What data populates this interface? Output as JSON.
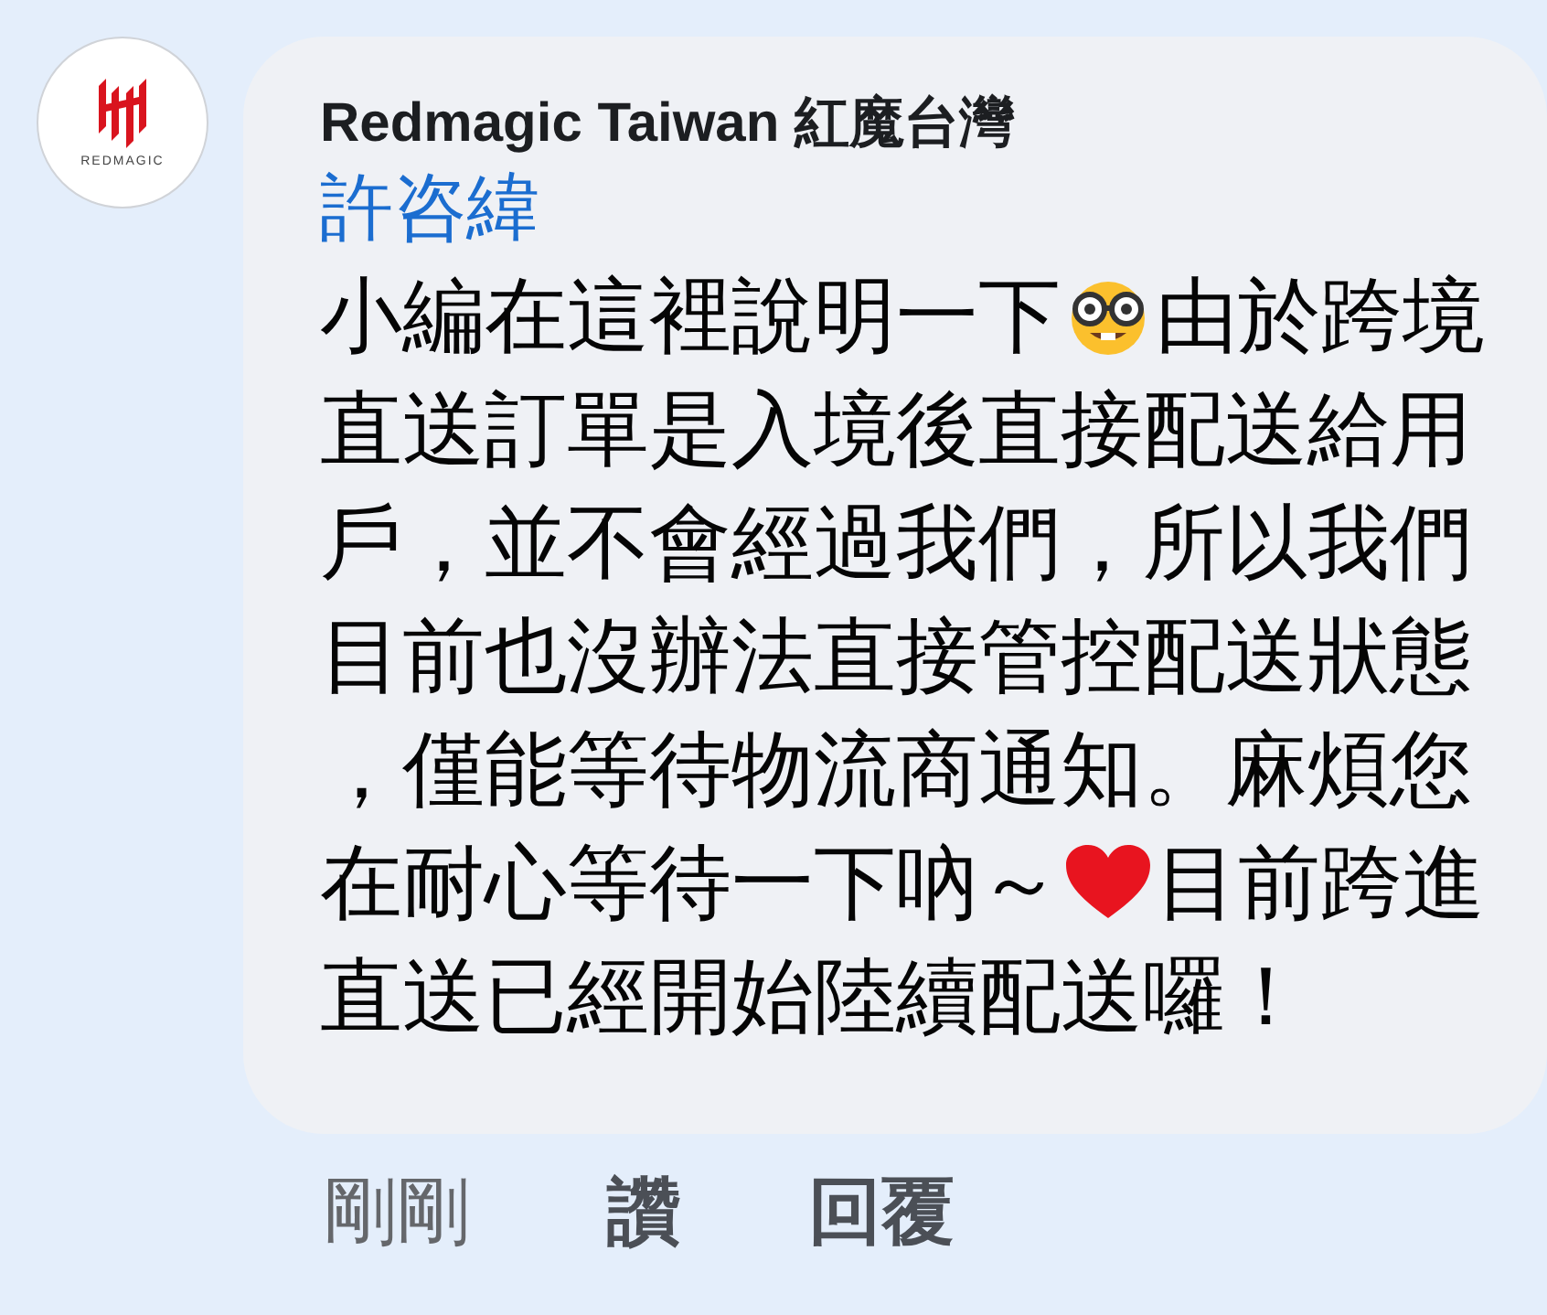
{
  "comment": {
    "avatar": {
      "logo_text": "REDMAGIC"
    },
    "author": "Redmagic Taiwan 紅魔台灣",
    "mention": "許咨緯",
    "body_lines": [
      [
        {
          "kind": "text",
          "text": "小編在這裡說明一下"
        },
        {
          "kind": "nerd_emoji"
        },
        {
          "kind": "text",
          "text": "由於跨境"
        }
      ],
      [
        {
          "kind": "text",
          "text": "直送訂單是入境後直接配送給用"
        }
      ],
      [
        {
          "kind": "text",
          "text": "戶，並不會經過我們，所以我們"
        }
      ],
      [
        {
          "kind": "text",
          "text": "目前也沒辦法直接管控配送狀態"
        }
      ],
      [
        {
          "kind": "text",
          "text": "，僅能等待物流商通知。麻煩您"
        }
      ],
      [
        {
          "kind": "text",
          "text": "在耐心等待一下吶～"
        },
        {
          "kind": "heart_emoji"
        },
        {
          "kind": "text",
          "text": "目前跨進"
        }
      ],
      [
        {
          "kind": "text",
          "text": "直送已經開始陸續配送囉！"
        }
      ]
    ],
    "time": "剛剛",
    "actions": [
      "讚",
      "回覆"
    ]
  }
}
